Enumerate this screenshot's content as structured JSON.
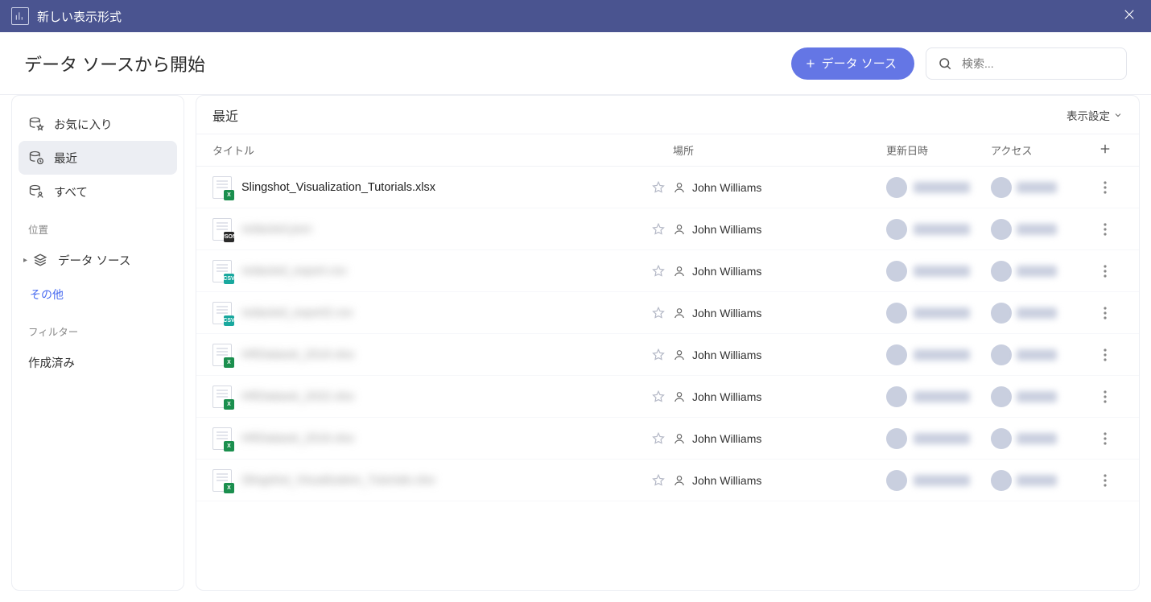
{
  "titlebar": {
    "title": "新しい表示形式"
  },
  "header": {
    "heading": "データ ソースから開始",
    "primary_button": "データ ソース",
    "search_placeholder": "検索..."
  },
  "sidebar": {
    "items": [
      {
        "key": "favorites",
        "label": "お気に入り",
        "icon": "db-star"
      },
      {
        "key": "recent",
        "label": "最近",
        "icon": "db-clock",
        "active": true
      },
      {
        "key": "all",
        "label": "すべて",
        "icon": "db-user"
      }
    ],
    "group_location_label": "位置",
    "location_item": {
      "label": "データ ソース"
    },
    "more_link": "その他",
    "group_filter_label": "フィルター",
    "filter_item": {
      "label": "作成済み"
    }
  },
  "panel": {
    "title": "最近",
    "view_settings": "表示設定",
    "columns": {
      "title": "タイトル",
      "location": "場所",
      "date": "更新日時",
      "access": "アクセス"
    },
    "rows": [
      {
        "name": "Slingshot_Visualization_Tutorials.xlsx",
        "badge": "xlsx",
        "badge_text": "X",
        "blur": false,
        "owner": "John Williams"
      },
      {
        "name": "redacted.json",
        "badge": "json",
        "badge_text": "JSON",
        "blur": true,
        "owner": "John Williams"
      },
      {
        "name": "redacted_export.csv",
        "badge": "csv",
        "badge_text": "CSV",
        "blur": true,
        "owner": "John Williams"
      },
      {
        "name": "redacted_export2.csv",
        "badge": "csv",
        "badge_text": "CSV",
        "blur": true,
        "owner": "John Williams"
      },
      {
        "name": "HRDataset_2019.xlsx",
        "badge": "xlsx",
        "badge_text": "X",
        "blur": true,
        "owner": "John Williams"
      },
      {
        "name": "HRDataset_2022.xlsx",
        "badge": "xlsx",
        "badge_text": "X",
        "blur": true,
        "owner": "John Williams"
      },
      {
        "name": "HRDataset_2016.xlsx",
        "badge": "xlsx",
        "badge_text": "X",
        "blur": true,
        "owner": "John Williams"
      },
      {
        "name": "Slingshot_Visualization_Tutorials.xlsx",
        "badge": "xlsx",
        "badge_text": "X",
        "blur": true,
        "owner": "John Williams"
      }
    ]
  }
}
